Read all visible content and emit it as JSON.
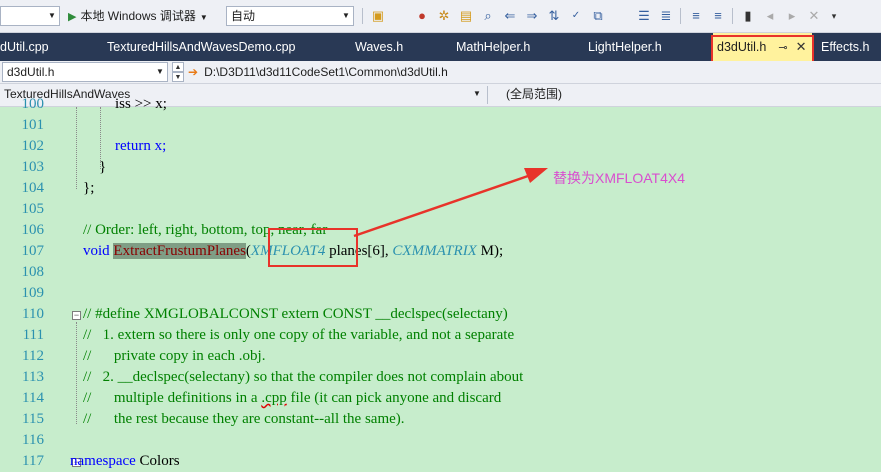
{
  "toolbar": {
    "config_dropdown": "",
    "debugger_label": "本地 Windows 调试器",
    "mode_dropdown": "自动"
  },
  "tabs": [
    {
      "label": "dUtil.cpp"
    },
    {
      "label": "TexturedHillsAndWavesDemo.cpp"
    },
    {
      "label": "Waves.h"
    },
    {
      "label": "MathHelper.h"
    },
    {
      "label": "LightHelper.h"
    },
    {
      "label": "d3dUtil.h",
      "active": true
    },
    {
      "label": "Effects.h"
    }
  ],
  "nav1": {
    "file_dropdown": "d3dUtil.h",
    "path": "D:\\D3D11\\d3d11CodeSet1\\Common\\d3dUtil.h"
  },
  "nav2": {
    "project_dropdown": "TexturedHillsAndWaves",
    "scope_dropdown": "(全局范围)"
  },
  "editor": {
    "lines": [
      {
        "n": "100",
        "text": "iss >> x;"
      },
      {
        "n": "101",
        "text": ""
      },
      {
        "n": "102",
        "text": "return x;"
      },
      {
        "n": "103",
        "text": "}"
      },
      {
        "n": "104",
        "text": "};"
      },
      {
        "n": "105",
        "text": ""
      },
      {
        "n": "106",
        "text": "// Order: left, right, bottom, top, near, far"
      },
      {
        "n": "107",
        "kw": "void",
        "fn": "ExtractFrustumPlanes",
        "p1": "(",
        "ty1": "XMFLOAT4",
        "p2": " planes[6], ",
        "ty2": "CXMMATRIX",
        "p3": " M);"
      },
      {
        "n": "108",
        "text": ""
      },
      {
        "n": "109",
        "text": ""
      },
      {
        "n": "110",
        "text": "// #define XMGLOBALCONST extern CONST __declspec(selectany)"
      },
      {
        "n": "111",
        "text": "//   1. extern so there is only one copy of the variable, and not a separate"
      },
      {
        "n": "112",
        "text": "//      private copy in each .obj."
      },
      {
        "n": "113",
        "text": "//   2. __declspec(selectany) so that the compiler does not complain about"
      },
      {
        "n": "114",
        "pre": "//      multiple definitions in a ",
        "sq": ".cpp",
        "post": " file (it can pick anyone and discard"
      },
      {
        "n": "115",
        "text": "//      the rest because they are constant--all the same)."
      },
      {
        "n": "116",
        "text": ""
      },
      {
        "n": "117",
        "kw": "namespace",
        "rest": " Colors"
      }
    ]
  },
  "annotation": {
    "text": "替换为XMFLOAT4X4"
  },
  "colors": {
    "editor_bg": "#c7edcc",
    "tab_bar": "#293955",
    "active_tab": "#fff29d",
    "highlight_box": "#e8332a",
    "annotation_text": "#d94ecf"
  }
}
